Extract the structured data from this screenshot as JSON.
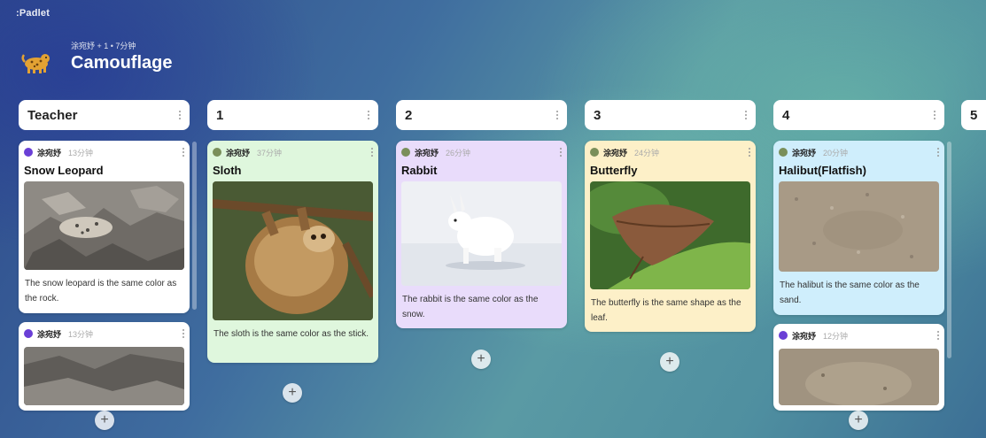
{
  "app": {
    "brand": "Padlet"
  },
  "header": {
    "meta": "涂宛妤 + 1 • 7分钟",
    "title": "Camouflage",
    "icon": "leopard-icon"
  },
  "columns": [
    {
      "title": "Teacher",
      "cards": [
        {
          "author": "涂宛妤",
          "time": "13分钟",
          "title": "Snow Leopard",
          "text": "The snow leopard is the same color as the rock.",
          "bg": "#ffffff",
          "image": "snow-leopard-on-rocks"
        },
        {
          "author": "涂宛妤",
          "time": "13分钟",
          "title": "",
          "text": "",
          "bg": "#ffffff",
          "image": "camouflaged-animal-on-gravel"
        }
      ]
    },
    {
      "title": "1",
      "cards": [
        {
          "author": "涂宛妤",
          "time": "37分钟",
          "title": "Sloth",
          "text": "The sloth is the same color as the stick.",
          "bg": "#dff7dd",
          "image": "sloth-on-branch"
        }
      ]
    },
    {
      "title": "2",
      "cards": [
        {
          "author": "涂宛妤",
          "time": "26分钟",
          "title": "Rabbit",
          "text": "The rabbit is the same color as the snow.",
          "bg": "#e9dcfb",
          "image": "white-hare-on-snow"
        }
      ]
    },
    {
      "title": "3",
      "cards": [
        {
          "author": "涂宛妤",
          "time": "24分钟",
          "title": "Butterfly",
          "text": "The butterfly is the same shape as the leaf.",
          "bg": "#fdf0c8",
          "image": "leaf-butterfly"
        }
      ]
    },
    {
      "title": "4",
      "cards": [
        {
          "author": "涂宛妤",
          "time": "20分钟",
          "title": "Halibut(Flatfish)",
          "text": "The halibut is the same color as the sand.",
          "bg": "#cfeefc",
          "image": "halibut-on-sand"
        },
        {
          "author": "涂宛妤",
          "time": "12分钟",
          "title": "",
          "text": "",
          "bg": "#ffffff",
          "image": "flatfish-on-sand"
        }
      ]
    },
    {
      "title": "5",
      "cards": []
    }
  ],
  "add_label": "+",
  "colors": {
    "accent_avatar": "#6a3fd6",
    "header_bg": "#ffffff"
  }
}
